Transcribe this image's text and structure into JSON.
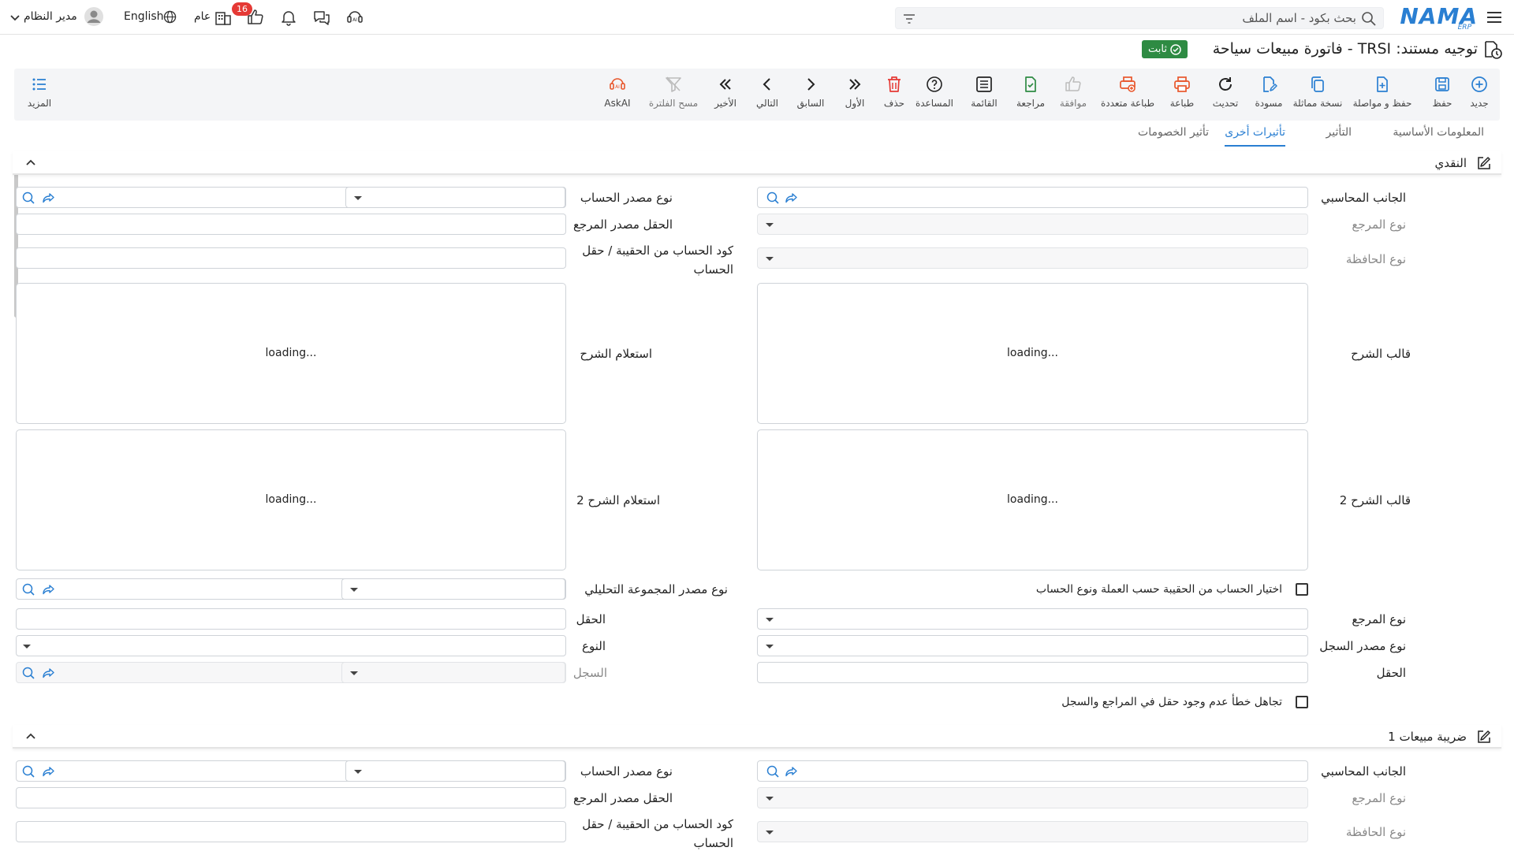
{
  "topbar": {
    "search_placeholder": "بحث بكود - اسم الملف",
    "logo_text": "NAMA",
    "logo_sub": "ERP",
    "user_name": "مدير النظام",
    "language": "English",
    "company": "عام",
    "notification_count": "16"
  },
  "title": {
    "text": "توجيه مستند: TRSI - فاتورة مبيعات سياحة",
    "status": "ثابت"
  },
  "toolbar": {
    "new": "جديد",
    "save": "حفظ",
    "save_continue": "حفظ و مواصلة",
    "duplicate": "نسخة مماثلة",
    "draft": "مسودة",
    "refresh": "تحديث",
    "print": "طباعة",
    "multi_print": "طباعة متعددة",
    "approve": "موافقة",
    "review": "مراجعة",
    "list": "القائمة",
    "help": "المساعدة",
    "delete": "حذف",
    "first": "الأول",
    "previous": "السابق",
    "next": "التالي",
    "last": "الأخير",
    "clear_filter": "مسح الفلترة",
    "askai": "AskAI",
    "more": "المزيد"
  },
  "tabs": {
    "basic": "المعلومات الأساسية",
    "effect": "التأثير",
    "other_effects": "تأثيرات أخرى",
    "discount_effect": "تأثير الخصومات"
  },
  "section_cash": {
    "title": "النقدي",
    "accounting_side": "الجانب المحاسبي",
    "account_source_type": "نوع مصدر الحساب",
    "reference_type": "نوع المرجع",
    "reference_source_field": "الحقل مصدر المرجع",
    "portfolio_type": "نوع الحافظة",
    "account_code_label": "كود الحساب من الحقيبة / حقل الحساب",
    "narration_template": "قالب الشرح",
    "narration_query": "استعلام الشرح",
    "narration_template2": "قالب الشرح 2",
    "narration_query2": "استعلام الشرح 2",
    "loading": "loading...",
    "analytic_source_type": "نوع مصدر المجموعة التحليلي",
    "choose_account_checkbox": "اختيار الحساب من الحقيبة حسب العملة ونوع الحساب",
    "ref_type2": "نوع المرجع",
    "field": "الحقل",
    "record_source_type": "نوع مصدر السجل",
    "type": "النوع",
    "field2": "الحقل",
    "record": "السجل",
    "ignore_error_checkbox": "تجاهل خطأ عدم وجود حقل في المراجع والسجل"
  },
  "section_tax": {
    "title": "ضريبة مبيعات 1",
    "accounting_side": "الجانب المحاسبي",
    "account_source_type": "نوع مصدر الحساب",
    "reference_type": "نوع المرجع",
    "reference_source_field": "الحقل مصدر المرجع",
    "portfolio_type": "نوع الحافظة",
    "account_code_label": "كود الحساب من الحقيبة / حقل الحساب"
  },
  "colors": {
    "accent": "#2a7fd2",
    "status": "#2e8b43",
    "badge": "#e53935"
  }
}
